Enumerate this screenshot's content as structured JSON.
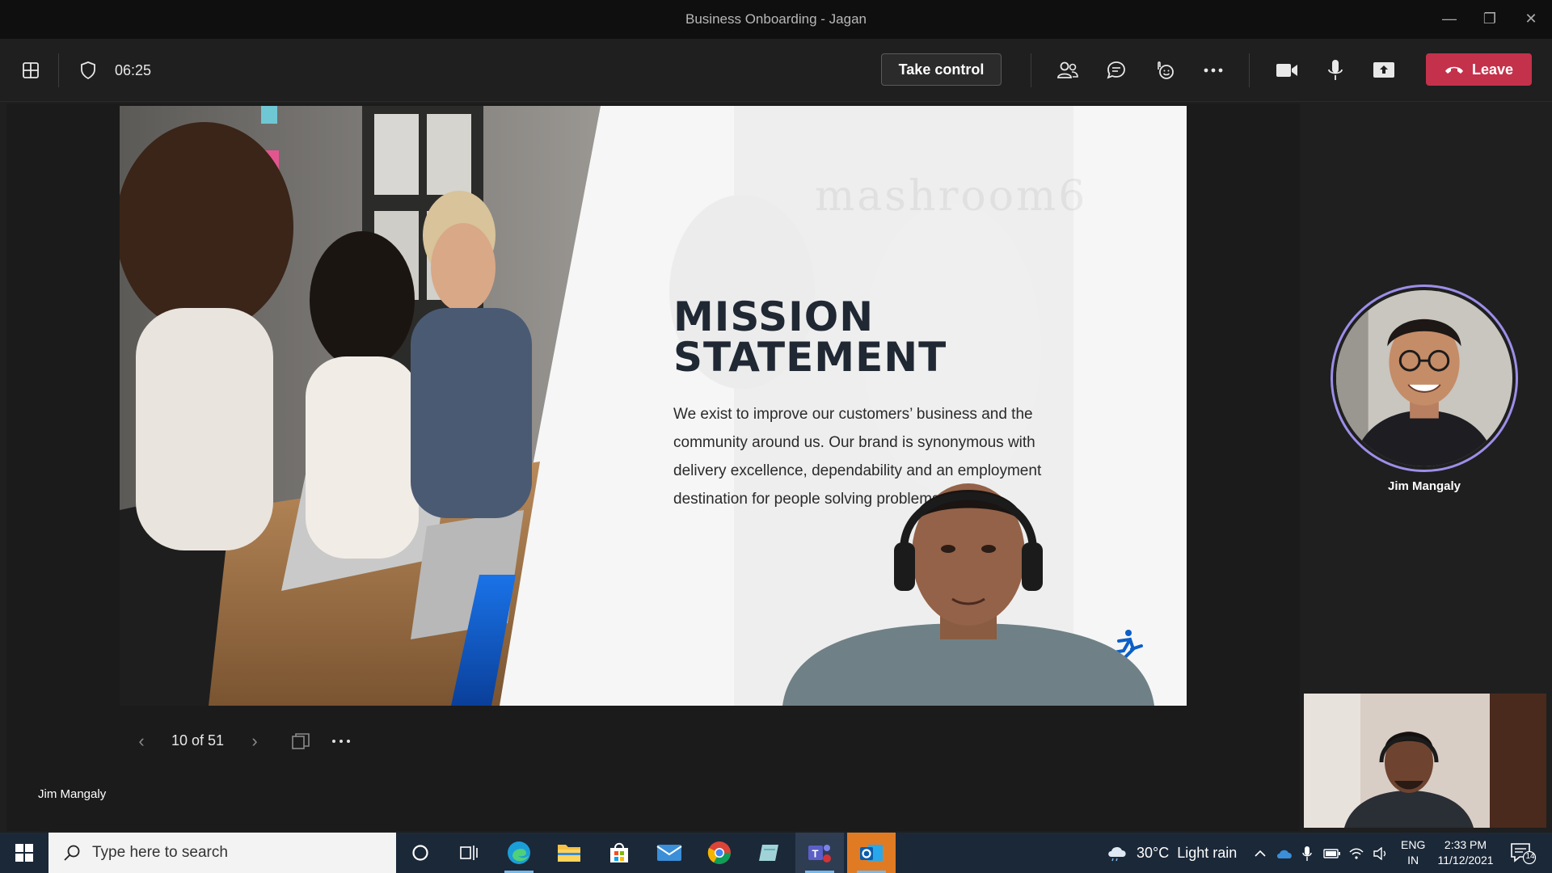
{
  "window": {
    "title": "Business Onboarding - Jagan"
  },
  "toolbar": {
    "timer": "06:25",
    "take_control_label": "Take control",
    "leave_label": "Leave",
    "icons": [
      "layout-icon",
      "shield-icon",
      "participants-icon",
      "chat-icon",
      "reactions-icon",
      "more-icon",
      "camera-icon",
      "mic-icon",
      "share-icon"
    ]
  },
  "slide": {
    "title_line1": "MISSION",
    "title_line2": "STATEMENT",
    "body": "We exist to improve our customers’ business and the community around us. Our brand is synonymous with delivery excellence, dependability and an employment destination for people solving problems.",
    "watermark": "mashroom6",
    "counter": "10 of 51"
  },
  "presenter": {
    "name": "Jim Mangaly"
  },
  "participants": [
    {
      "name": "Jim Mangaly"
    }
  ],
  "taskbar": {
    "search_placeholder": "Type here to search",
    "weather_temp": "30°C",
    "weather_text": "Light rain",
    "lang_line1": "ENG",
    "lang_line2": "IN",
    "time": "2:33 PM",
    "date": "11/12/2021",
    "notification_count": "14",
    "apps": [
      "cortana-icon",
      "task-view-icon",
      "edge-icon",
      "file-explorer-icon",
      "store-icon",
      "mail-icon",
      "chrome-icon",
      "notes-icon",
      "teams-icon",
      "outlook-icon"
    ]
  },
  "colors": {
    "leave": "#c4314b",
    "accent_ring": "#9d8ee8",
    "taskbar": "#1b2838",
    "slide_blue": "#0b5fc7"
  }
}
